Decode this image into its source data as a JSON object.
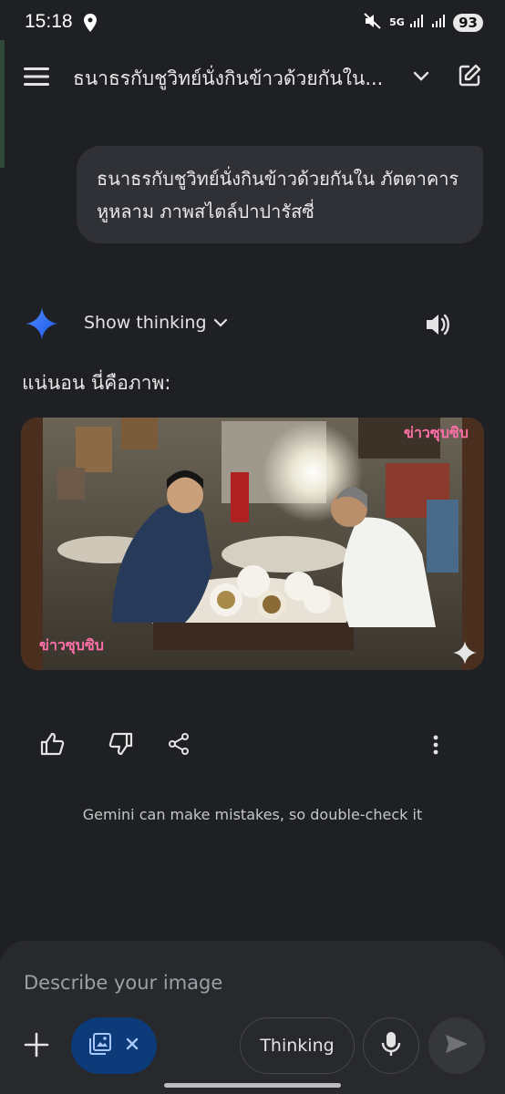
{
  "status": {
    "time": "15:18",
    "network": "5G",
    "battery": "93"
  },
  "header": {
    "title": "ธนาธรกับชูวิทย์นั่งกินข้าวด้วยกันใน..."
  },
  "conversation": {
    "user_prompt": "ธนาธรกับชูวิทย์นั่งกินข้าวด้วยกันใน ภัตตาคารหูหลาม ภาพสไตล์ปาปารัสซี่",
    "show_thinking_label": "Show thinking",
    "response_text": "แน่นอน นี่คือภาพ:",
    "image_watermark": "ข่าวซุบซิบ"
  },
  "footer": {
    "disclaimer": "Gemini can make mistakes, so double-check it"
  },
  "composer": {
    "placeholder": "Describe your image",
    "thinking_label": "Thinking"
  },
  "colors": {
    "background": "#1f2023",
    "bubble": "#303136",
    "accent": "#0d3b7a",
    "watermark": "#ff6fa8"
  }
}
